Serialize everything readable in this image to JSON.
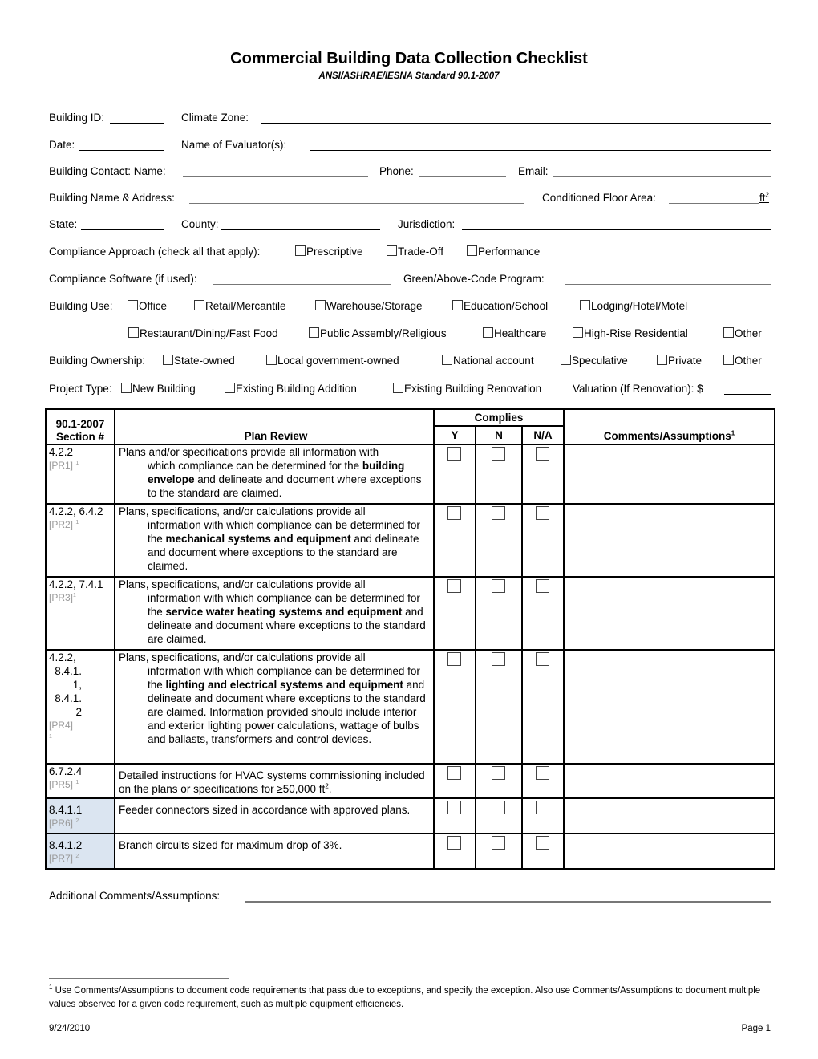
{
  "header": {
    "title": "Commercial Building Data Collection Checklist",
    "subtitle": "ANSI/ASHRAE/IESNA Standard 90.1-2007"
  },
  "fields": {
    "building_id": "Building ID:",
    "climate_zone": "Climate Zone:",
    "date": "Date:",
    "evaluators": "Name of Evaluator(s):",
    "contact_name": "Building Contact:  Name:",
    "phone": "Phone:",
    "email": "Email:",
    "name_address": "Building Name & Address:",
    "floor_area": "Conditioned Floor Area:",
    "floor_area_unit": "ft",
    "floor_area_unit_sup": "2",
    "state": "State:",
    "county": "County:",
    "jurisdiction": "Jurisdiction:",
    "software": "Compliance Software (if used):",
    "green_program": "Green/Above-Code Program:"
  },
  "compliance_approach": {
    "label": "Compliance Approach (check all that apply):",
    "options": [
      "Prescriptive",
      "Trade-Off",
      "Performance"
    ]
  },
  "building_use": {
    "label": "Building Use:",
    "options": [
      "Office",
      "Retail/Mercantile",
      "Warehouse/Storage",
      "Education/School",
      "Lodging/Hotel/Motel",
      "Restaurant/Dining/Fast Food",
      "Public Assembly/Religious",
      "Healthcare",
      "High-Rise Residential",
      "Other"
    ]
  },
  "ownership": {
    "label": "Building Ownership:",
    "options": [
      "State-owned",
      "Local government-owned",
      "National account",
      "Speculative",
      "Private",
      "Other"
    ]
  },
  "project_type": {
    "label": "Project Type:",
    "options": [
      "New Building",
      "Existing Building Addition",
      "Existing Building Renovation"
    ],
    "valuation": "Valuation (If Renovation): $"
  },
  "table": {
    "headers": {
      "section_1": "90.1-2007",
      "section_2": "Section #",
      "plan_review": "Plan Review",
      "complies": "Complies",
      "y": "Y",
      "n": "N",
      "na": "N/A",
      "comments": "Comments/Assumptions",
      "comments_sup": "1"
    },
    "rows": [
      {
        "section": "4.2.2",
        "ref": "[PR1]",
        "ref_sup": "1",
        "first": "Plans and/or specifications provide all information with",
        "rest_pre": "which compliance can be determined for the ",
        "bold": "building envelope",
        "rest_post": " and delineate and document where exceptions to the standard are claimed."
      },
      {
        "section": "4.2.2, 6.4.2",
        "ref": "[PR2]",
        "ref_sup": "1",
        "first": "Plans, specifications, and/or calculations provide all",
        "rest_pre": "information with which compliance can be determined for the ",
        "bold": "mechanical systems and equipment",
        "rest_post": " and delineate and document where exceptions to the standard are claimed."
      },
      {
        "section": "4.2.2, 7.4.1",
        "ref": "[PR3]",
        "ref_sup": "1",
        "first": "Plans, specifications, and/or calculations provide all",
        "rest_pre": "information with which compliance can be determined for the ",
        "bold": "service water heating systems and equipment",
        "rest_post": " and delineate and document where exceptions to the standard are claimed."
      },
      {
        "section_lines": [
          "4.2.2,",
          "8.4.1.",
          "1,",
          "8.4.1.",
          "2"
        ],
        "ref": "[PR4]",
        "ref_sup": "1",
        "first": "Plans, specifications, and/or calculations provide all",
        "rest_pre": "information with which compliance can be determined for the ",
        "bold": "lighting and electrical systems and equipment",
        "rest_post": " and delineate and document where exceptions to the standard are claimed. Information provided should include interior and exterior lighting power calculations, wattage of bulbs and ballasts, transformers and control devices."
      },
      {
        "section": "6.7.2.4",
        "ref": "[PR5]",
        "ref_sup": "1",
        "text": "Detailed instructions for HVAC systems commissioning included on the plans or specifications for ≥50,000 ft",
        "text_sup": "2",
        "text_end": "."
      },
      {
        "section": "8.4.1.1",
        "ref": "[PR6]",
        "ref_sup": "2",
        "text": "Feeder connectors sized in accordance with approved plans.",
        "shaded": true
      },
      {
        "section": "8.4.1.2",
        "ref": "[PR7]",
        "ref_sup": "2",
        "text": "Branch circuits sized for maximum drop of 3%.",
        "shaded": true
      }
    ]
  },
  "additional_comments": "Additional Comments/Assumptions:",
  "footnote": {
    "marker": "1",
    "text": " Use Comments/Assumptions to document code requirements that pass due to exceptions, and specify the exception. Also use Comments/Assumptions to document multiple values observed for a given code requirement, such as multiple equipment efficiencies."
  },
  "footer": {
    "date": "9/24/2010",
    "page": "Page 1"
  },
  "colors": {
    "shaded_cell": "#dbe5f1",
    "ref_gray": "#999999"
  }
}
